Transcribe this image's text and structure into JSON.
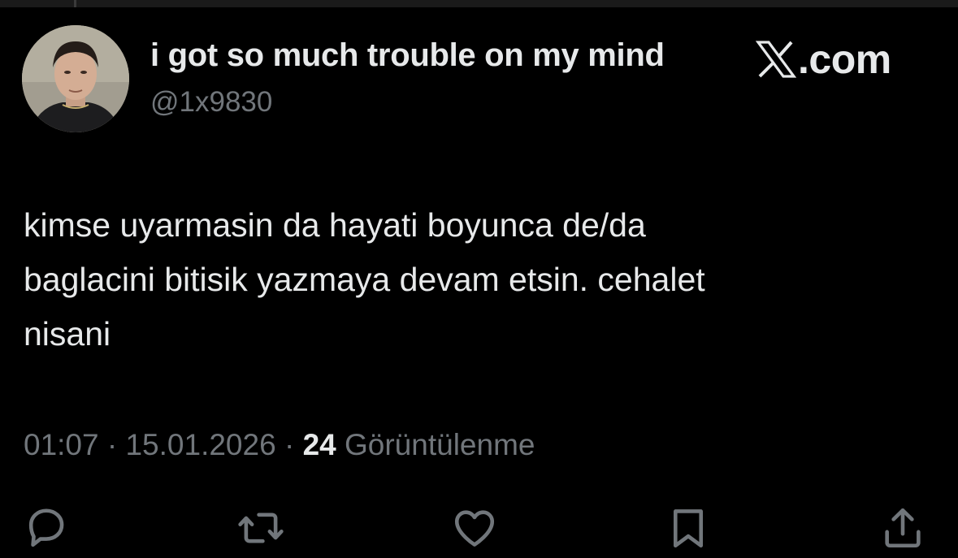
{
  "author": {
    "display_name": "i got so much trouble on my mind",
    "handle": "@1x9830"
  },
  "brand": {
    "icon": "x-logo-icon",
    "text": ".com"
  },
  "tweet": {
    "lines": [
      "kimse uyarmasin da hayati boyunca de/da",
      "baglacini bitisik yazmaya devam etsin. cehalet",
      "nisani"
    ]
  },
  "meta": {
    "time": "01:07",
    "sep1": " · ",
    "date": "15.01.2026",
    "sep2": " · ",
    "views_count": "24",
    "views_label": " Görüntülenme"
  },
  "actions": [
    {
      "name": "reply",
      "icon": "reply-icon"
    },
    {
      "name": "repost",
      "icon": "repost-icon"
    },
    {
      "name": "like",
      "icon": "heart-icon"
    },
    {
      "name": "bookmark",
      "icon": "bookmark-icon"
    },
    {
      "name": "share",
      "icon": "share-icon"
    }
  ],
  "colors": {
    "background": "#000000",
    "primary_text": "#e7e9ea",
    "secondary_text": "#71767b"
  }
}
